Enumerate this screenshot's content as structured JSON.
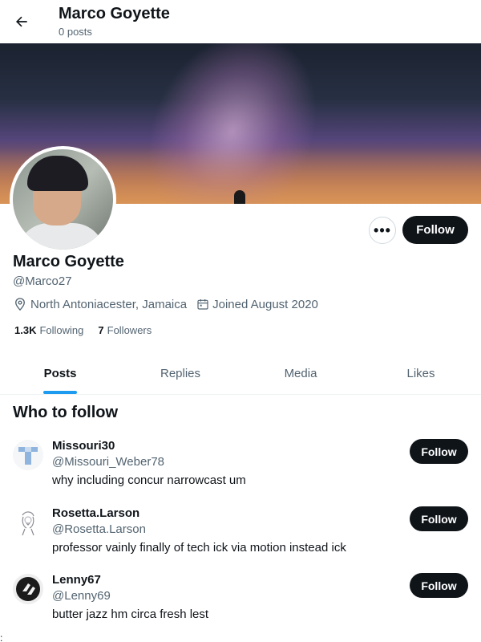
{
  "header": {
    "back_icon": "arrow-left-icon",
    "name": "Marco Goyette",
    "posts": "0 posts"
  },
  "profile": {
    "name": "Marco Goyette",
    "handle": "@Marco27",
    "location": "North Antoniacester, Jamaica",
    "joined": "Joined August 2020",
    "following_count": "1.3K",
    "following_label": "Following",
    "followers_count": "7",
    "followers_label": "Followers",
    "more_label": "•••",
    "follow_label": "Follow"
  },
  "tabs": [
    {
      "label": "Posts",
      "active": true
    },
    {
      "label": "Replies",
      "active": false
    },
    {
      "label": "Media",
      "active": false
    },
    {
      "label": "Likes",
      "active": false
    }
  ],
  "who_to_follow": {
    "title": "Who to follow",
    "items": [
      {
        "name": "Missouri30",
        "handle": "@Missouri_Weber78",
        "bio": "why including concur narrowcast um",
        "follow": "Follow"
      },
      {
        "name": "Rosetta.Larson",
        "handle": "@Rosetta.Larson",
        "bio": "professor vainly finally of tech ick via motion instead ick",
        "follow": "Follow"
      },
      {
        "name": "Lenny67",
        "handle": "@Lenny69",
        "bio": "butter jazz hm circa fresh lest",
        "follow": "Follow"
      }
    ]
  },
  "edge_mark": ":",
  "colors": {
    "accent": "#1d9bf0",
    "button_dark": "#0f1419",
    "muted_text": "#536471"
  }
}
